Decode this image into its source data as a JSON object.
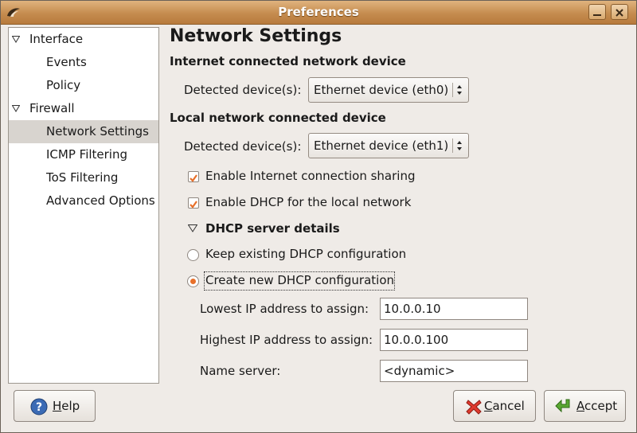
{
  "window": {
    "title": "Preferences"
  },
  "sidebar": {
    "items": [
      {
        "label": "Interface",
        "level": 0,
        "expanded": true
      },
      {
        "label": "Events",
        "level": 1
      },
      {
        "label": "Policy",
        "level": 1
      },
      {
        "label": "Firewall",
        "level": 0,
        "expanded": true
      },
      {
        "label": "Network Settings",
        "level": 1,
        "selected": true
      },
      {
        "label": "ICMP Filtering",
        "level": 1
      },
      {
        "label": "ToS Filtering",
        "level": 1
      },
      {
        "label": "Advanced Options",
        "level": 1
      }
    ]
  },
  "main": {
    "title": "Network Settings",
    "internet_section": "Internet connected network device",
    "internet_detected_label": "Detected device(s):",
    "internet_device": "Ethernet device (eth0)",
    "local_section": "Local network connected device",
    "local_detected_label": "Detected device(s):",
    "local_device": "Ethernet device (eth1)",
    "enable_sharing": {
      "label": "Enable Internet connection sharing",
      "checked": true
    },
    "enable_dhcp": {
      "label": "Enable DHCP for the local network",
      "checked": true
    },
    "dhcp_details": "DHCP server details",
    "keep_existing": {
      "label": "Keep existing DHCP configuration",
      "selected": false
    },
    "create_new": {
      "label": "Create new DHCP configuration",
      "selected": true
    },
    "lowest_ip_label": "Lowest IP address to assign:",
    "lowest_ip": "10.0.0.10",
    "highest_ip_label": "Highest IP address to assign:",
    "highest_ip": "10.0.0.100",
    "name_server_label": "Name server:",
    "name_server": "<dynamic>"
  },
  "buttons": {
    "help_mnemonic": "H",
    "help_rest": "elp",
    "cancel_mnemonic": "C",
    "cancel_rest": "ancel",
    "accept_mnemonic": "A",
    "accept_rest": "ccept"
  },
  "colors": {
    "titlebar": "#c58c4f",
    "accent": "#e8702a",
    "check": "#e8702a",
    "selected_row": "#d8d4cf"
  },
  "icons": {
    "help": "help-icon",
    "cancel": "cancel-x-icon",
    "accept": "accept-arrow-icon"
  }
}
